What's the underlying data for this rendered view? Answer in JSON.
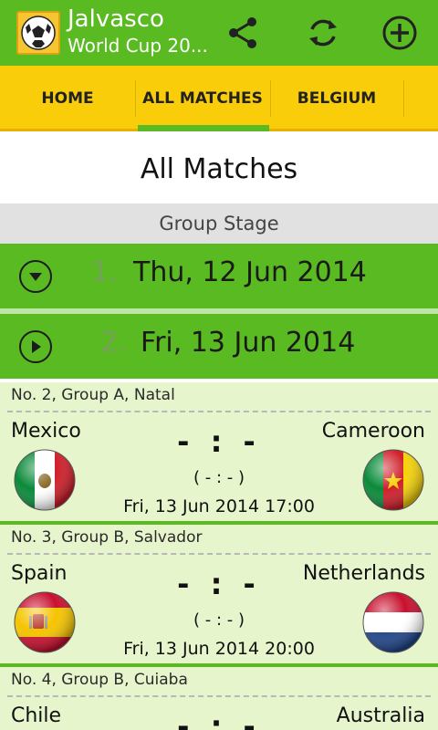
{
  "app": {
    "title": "Jalvasco",
    "subtitle": "World Cup 20..."
  },
  "actions": {
    "share_icon": "share-icon",
    "refresh_icon": "refresh-icon",
    "add_icon": "add-circle-icon"
  },
  "tabs": [
    {
      "label": "HOME"
    },
    {
      "label": "ALL MATCHES",
      "selected": true
    },
    {
      "label": "BELGIUM"
    }
  ],
  "page": {
    "title": "All Matches",
    "stage": "Group Stage"
  },
  "days": [
    {
      "number": "1.",
      "date": "Thu, 12 Jun 2014",
      "state": "expanded"
    },
    {
      "number": "2.",
      "date": "Fri, 13 Jun 2014",
      "state": "collapsed"
    }
  ],
  "matches": [
    {
      "header": "No. 2, Group A, Natal",
      "home": "Mexico",
      "away": "Cameroon",
      "score": "- : -",
      "sub_score": "( - : - )",
      "kickoff": "Fri, 13 Jun 2014 17:00"
    },
    {
      "header": "No. 3, Group B, Salvador",
      "home": "Spain",
      "away": "Netherlands",
      "score": "- : -",
      "sub_score": "( - : - )",
      "kickoff": "Fri, 13 Jun 2014 20:00"
    },
    {
      "header": "No. 4, Group B, Cuiaba",
      "home": "Chile",
      "away": "Australia",
      "score": "- : -"
    }
  ],
  "colors": {
    "primary_green": "#5aba22",
    "tab_yellow": "#f9cd0a",
    "card_bg": "#e6f5cc"
  }
}
